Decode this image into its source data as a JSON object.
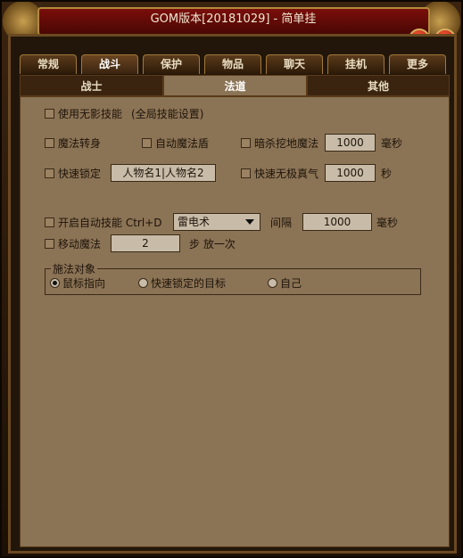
{
  "window": {
    "title": "GOM版本[20181029] - 简单挂",
    "minimize_icon": "chevron-down-icon",
    "close_icon": "close-icon",
    "minimize_glyph": "▾",
    "close_glyph": "✕"
  },
  "tabs": [
    "常规",
    "战斗",
    "保护",
    "物品",
    "聊天",
    "挂机",
    "更多"
  ],
  "active_tab": "战斗",
  "subtabs": [
    "战士",
    "法道",
    "其他"
  ],
  "active_subtab": "法道",
  "options": {
    "shadowless": {
      "label": "使用无影技能",
      "note": "(全局技能设置)"
    },
    "magic_turn": {
      "label": "魔法转身"
    },
    "auto_shield": {
      "label": "自动魔法盾"
    },
    "assassin_dig": {
      "label": "暗杀挖地魔法",
      "value": "1000",
      "unit": "毫秒"
    },
    "quick_lock": {
      "label": "快速锁定",
      "value": "人物名1|人物名2"
    },
    "quick_wuji": {
      "label": "快速无极真气",
      "value": "1000",
      "unit": "秒"
    },
    "auto_skill": {
      "label": "开启自动技能 Ctrl+D",
      "skill": "雷电术",
      "interval_label": "间隔",
      "interval": "1000",
      "unit": "毫秒"
    },
    "move_magic": {
      "label": "移动魔法",
      "steps": "2",
      "suffix": "步 放一次"
    }
  },
  "cast_target": {
    "title": "施法对象",
    "choices": [
      "鼠标指向",
      "快速锁定的目标",
      "自己"
    ],
    "selected": "鼠标指向"
  }
}
